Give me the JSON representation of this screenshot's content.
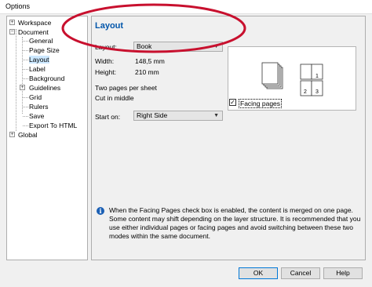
{
  "window": {
    "title": "Options"
  },
  "tree": {
    "workspace": "Workspace",
    "document": "Document",
    "children": [
      "General",
      "Page Size",
      "Layout",
      "Label",
      "Background",
      "Guidelines",
      "Grid",
      "Rulers",
      "Save",
      "Export To HTML"
    ],
    "global": "Global",
    "expander_plus": "+",
    "expander_minus": "−",
    "selected": "Layout"
  },
  "panel": {
    "title": "Layout",
    "layout_label": "Layout:",
    "layout_value": "Book",
    "width_label": "Width:",
    "width_value": "148,5 mm",
    "height_label": "Height:",
    "height_value": "210 mm",
    "desc1": "Two pages per sheet",
    "desc2": "Cut in middle",
    "start_label": "Start on:",
    "start_value": "Right Side",
    "facing_label": "Facing pages",
    "facing_checked": true,
    "preview_numbers": [
      "1",
      "2",
      "3"
    ],
    "info": "When the Facing Pages check box is enabled, the content is merged on one page. Some content may shift depending on the layer structure. It is recommended that you use either individual pages or facing pages and avoid switching between these two modes within the same document."
  },
  "buttons": {
    "ok": "OK",
    "cancel": "Cancel",
    "help": "Help"
  },
  "colors": {
    "title_blue": "#0055aa",
    "annotation_red": "#c8102e",
    "info_blue": "#1a5fb4"
  }
}
